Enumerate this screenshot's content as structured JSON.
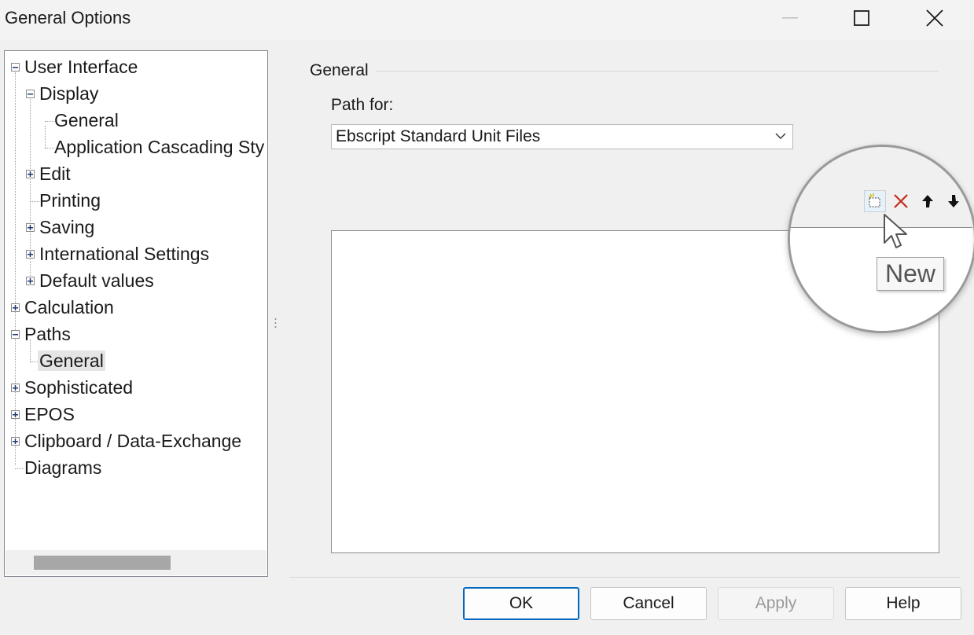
{
  "window": {
    "title": "General Options"
  },
  "tree": {
    "items": [
      {
        "label": "User Interface",
        "expander": "minus"
      },
      {
        "label": "Display",
        "expander": "minus"
      },
      {
        "label": "General",
        "expander": "none"
      },
      {
        "label": "Application Cascading Sty",
        "expander": "none"
      },
      {
        "label": "Edit",
        "expander": "plus"
      },
      {
        "label": "Printing",
        "expander": "none"
      },
      {
        "label": "Saving",
        "expander": "plus"
      },
      {
        "label": "International Settings",
        "expander": "plus"
      },
      {
        "label": "Default values",
        "expander": "plus"
      },
      {
        "label": "Calculation",
        "expander": "plus"
      },
      {
        "label": "Paths",
        "expander": "minus"
      },
      {
        "label": "General",
        "expander": "none",
        "selected": true
      },
      {
        "label": "Sophisticated",
        "expander": "plus"
      },
      {
        "label": "EPOS",
        "expander": "plus"
      },
      {
        "label": "Clipboard / Data-Exchange",
        "expander": "plus"
      },
      {
        "label": "Diagrams",
        "expander": "none"
      }
    ]
  },
  "panel": {
    "group_label": "General",
    "path_for_label": "Path for:",
    "path_for_value": "Ebscript Standard Unit Files"
  },
  "toolbar": {
    "icons": [
      "new-icon",
      "delete-icon",
      "move-up-icon",
      "move-down-icon"
    ],
    "tooltip": "New"
  },
  "buttons": {
    "ok": "OK",
    "cancel": "Cancel",
    "apply": "Apply",
    "help": "Help"
  },
  "colors": {
    "default_button_border": "#0067c0",
    "delete_icon": "#c42b1c"
  }
}
